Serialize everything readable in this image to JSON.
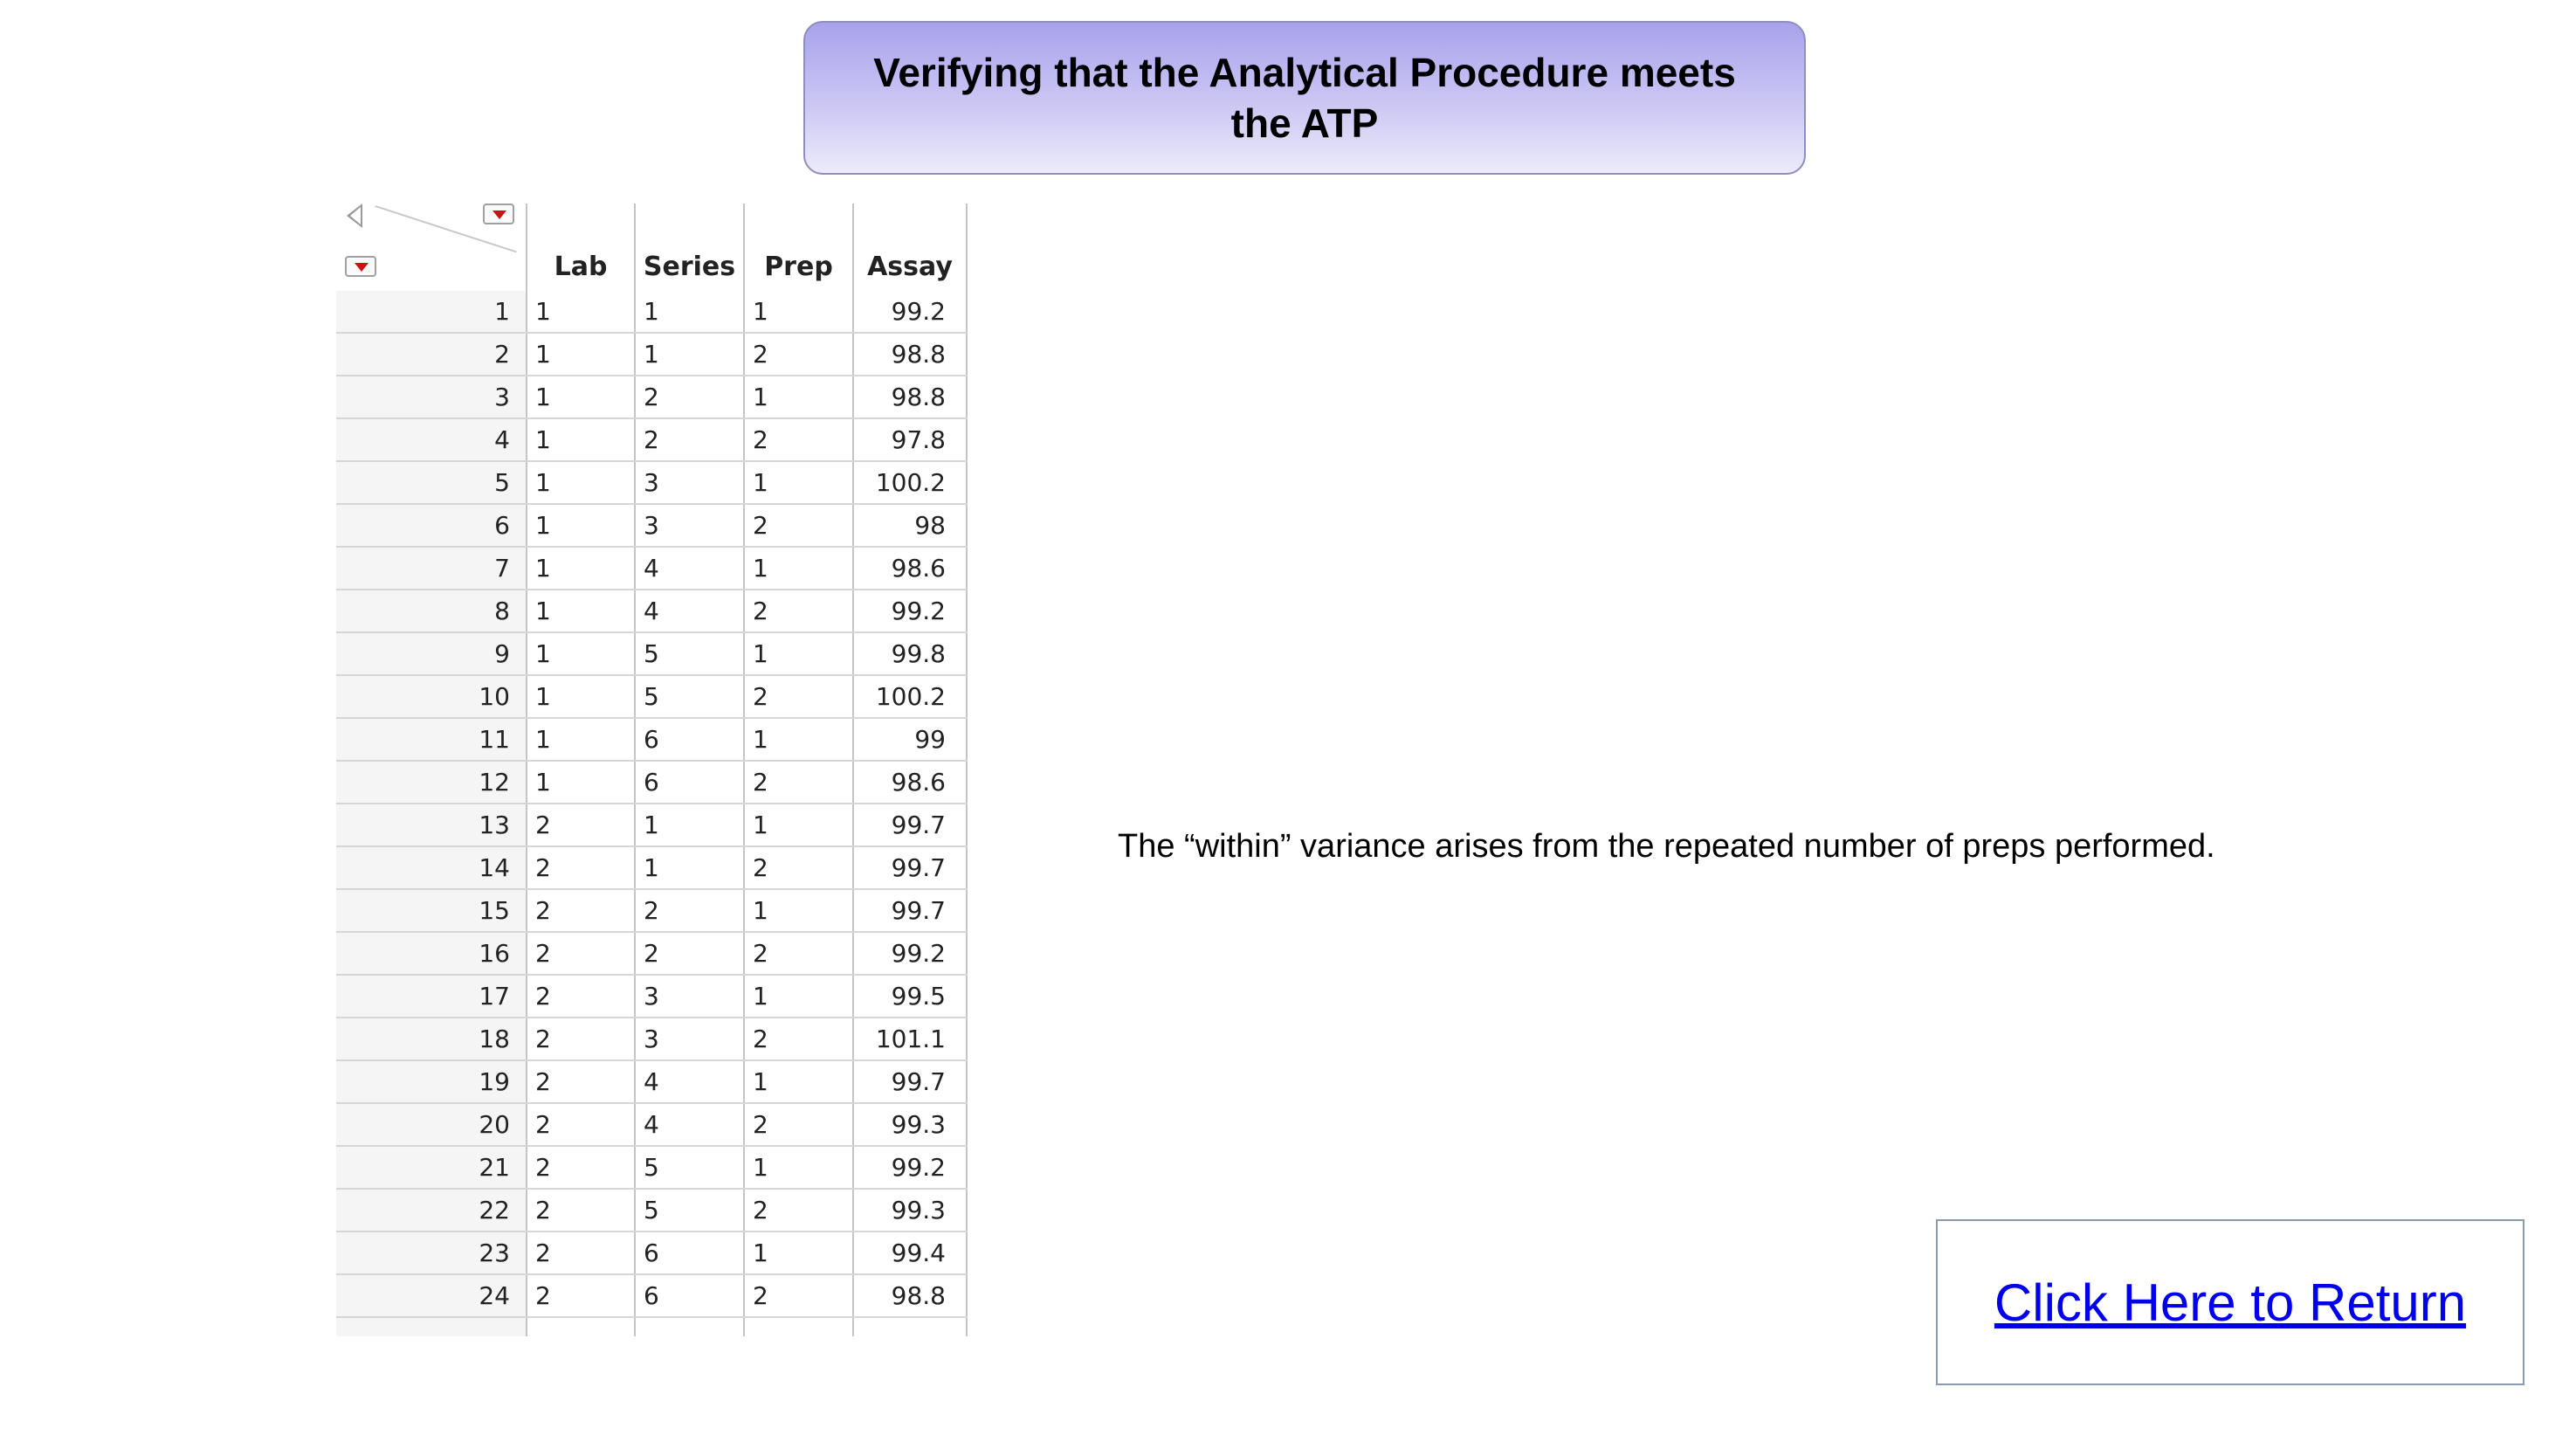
{
  "title": "Verifying that the Analytical Procedure meets the ATP",
  "table": {
    "columns": [
      "Lab",
      "Series",
      "Prep",
      "Assay"
    ],
    "rows": [
      {
        "n": "1",
        "lab": "1",
        "series": "1",
        "prep": "1",
        "assay": "99.2"
      },
      {
        "n": "2",
        "lab": "1",
        "series": "1",
        "prep": "2",
        "assay": "98.8"
      },
      {
        "n": "3",
        "lab": "1",
        "series": "2",
        "prep": "1",
        "assay": "98.8"
      },
      {
        "n": "4",
        "lab": "1",
        "series": "2",
        "prep": "2",
        "assay": "97.8"
      },
      {
        "n": "5",
        "lab": "1",
        "series": "3",
        "prep": "1",
        "assay": "100.2"
      },
      {
        "n": "6",
        "lab": "1",
        "series": "3",
        "prep": "2",
        "assay": "98"
      },
      {
        "n": "7",
        "lab": "1",
        "series": "4",
        "prep": "1",
        "assay": "98.6"
      },
      {
        "n": "8",
        "lab": "1",
        "series": "4",
        "prep": "2",
        "assay": "99.2"
      },
      {
        "n": "9",
        "lab": "1",
        "series": "5",
        "prep": "1",
        "assay": "99.8"
      },
      {
        "n": "10",
        "lab": "1",
        "series": "5",
        "prep": "2",
        "assay": "100.2"
      },
      {
        "n": "11",
        "lab": "1",
        "series": "6",
        "prep": "1",
        "assay": "99"
      },
      {
        "n": "12",
        "lab": "1",
        "series": "6",
        "prep": "2",
        "assay": "98.6"
      },
      {
        "n": "13",
        "lab": "2",
        "series": "1",
        "prep": "1",
        "assay": "99.7"
      },
      {
        "n": "14",
        "lab": "2",
        "series": "1",
        "prep": "2",
        "assay": "99.7"
      },
      {
        "n": "15",
        "lab": "2",
        "series": "2",
        "prep": "1",
        "assay": "99.7"
      },
      {
        "n": "16",
        "lab": "2",
        "series": "2",
        "prep": "2",
        "assay": "99.2"
      },
      {
        "n": "17",
        "lab": "2",
        "series": "3",
        "prep": "1",
        "assay": "99.5"
      },
      {
        "n": "18",
        "lab": "2",
        "series": "3",
        "prep": "2",
        "assay": "101.1"
      },
      {
        "n": "19",
        "lab": "2",
        "series": "4",
        "prep": "1",
        "assay": "99.7"
      },
      {
        "n": "20",
        "lab": "2",
        "series": "4",
        "prep": "2",
        "assay": "99.3"
      },
      {
        "n": "21",
        "lab": "2",
        "series": "5",
        "prep": "1",
        "assay": "99.2"
      },
      {
        "n": "22",
        "lab": "2",
        "series": "5",
        "prep": "2",
        "assay": "99.3"
      },
      {
        "n": "23",
        "lab": "2",
        "series": "6",
        "prep": "1",
        "assay": "99.4"
      },
      {
        "n": "24",
        "lab": "2",
        "series": "6",
        "prep": "2",
        "assay": "98.8"
      }
    ]
  },
  "note": "The “within” variance arises from the repeated number of  preps performed.",
  "return_link": "Click Here to Return",
  "colors": {
    "title_gradient_top": "#a8a2ec",
    "title_gradient_bottom": "#ecebfb",
    "link": "#0000ee",
    "menu_triangle": "#d01010"
  },
  "icons": [
    "collapse-left-triangle-icon",
    "red-triangle-menu-icon"
  ]
}
